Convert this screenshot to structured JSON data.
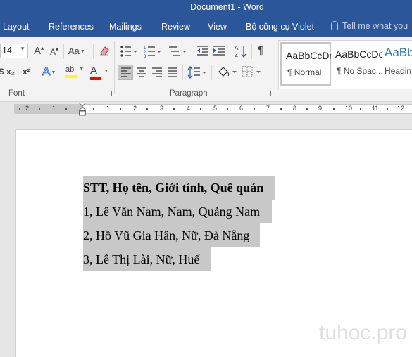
{
  "window": {
    "title": "Document1 - Word"
  },
  "tabs": [
    "Layout",
    "References",
    "Mailings",
    "Review",
    "View",
    "Bộ công cụ Violet"
  ],
  "tell_me": "Tell me what you",
  "font": {
    "size": "14",
    "group_label": "Font",
    "grow_label": "A",
    "shrink_label": "A",
    "change_case_label": "Aa",
    "subscript_label": "x₂",
    "superscript_label": "x²",
    "effects_label": "A",
    "highlight_label": "ab",
    "font_color_label": "A",
    "highlight_color": "#ffff00",
    "font_color": "#ff0000"
  },
  "paragraph": {
    "group_label": "Paragraph"
  },
  "styles": [
    {
      "sample": "AaBbCcDc",
      "name": "¶ Normal",
      "active": true
    },
    {
      "sample": "AaBbCcDc",
      "name": "¶ No Spac...",
      "active": false
    },
    {
      "sample": "AaBb",
      "name": "Headin",
      "active": false
    }
  ],
  "ruler": {
    "numbers": [
      "2",
      "1",
      "1",
      "2",
      "3",
      "4",
      "5",
      "6",
      "7",
      "8",
      "9",
      "10",
      "11",
      "12"
    ]
  },
  "document": {
    "lines": [
      {
        "text": "STT, Họ tên, Giới tính, Quê quán",
        "bold": true
      },
      {
        "text": "1, Lê Văn Nam, Nam, Quảng Nam",
        "bold": false
      },
      {
        "text": "2, Hồ Vũ Gia Hân, Nữ, Đà Nẵng",
        "bold": false
      },
      {
        "text": "3, Lê Thị Lài, Nữ, Huế",
        "bold": false
      }
    ],
    "selection_color": "#c8c8c8"
  },
  "watermark": "tuhoc.pro",
  "colors": {
    "title_bar": "#2b579a",
    "ribbon": "#f3f3f3",
    "canvas": "#e6e6e6"
  }
}
